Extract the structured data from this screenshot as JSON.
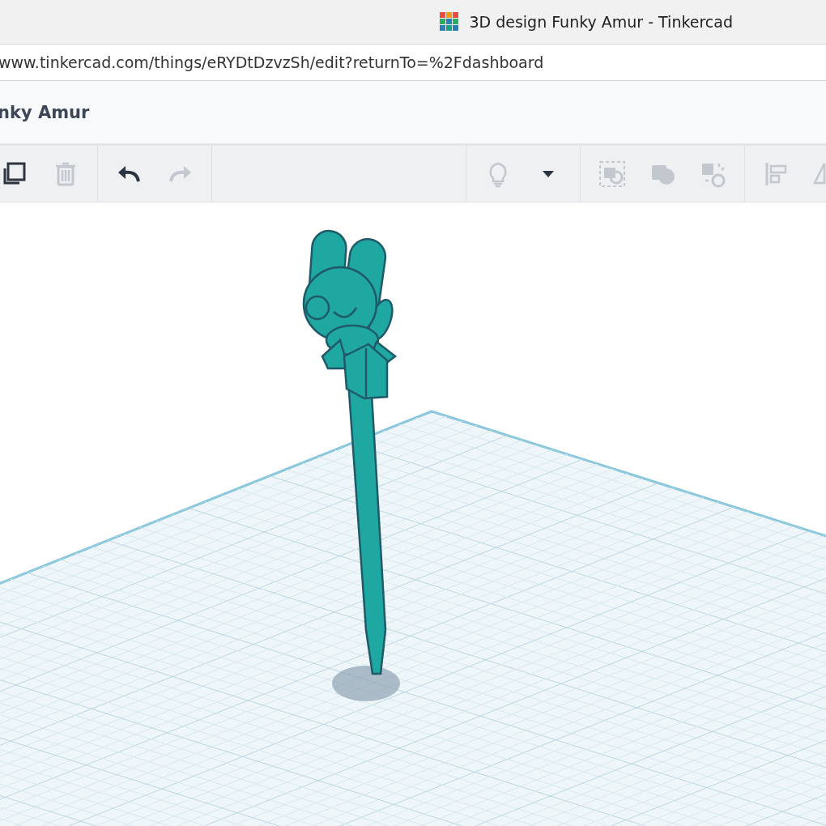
{
  "window": {
    "title": "3D design Funky Amur - Tinkercad"
  },
  "address_bar": {
    "url": "www.tinkercad.com/things/eRYDtDzvzSh/edit?returnTo=%2Fdashboard"
  },
  "header": {
    "title": "nky Amur"
  },
  "toolbar": {
    "left_groups": [
      [
        {
          "kind": "duplicate",
          "disabled": false
        },
        {
          "kind": "delete",
          "disabled": true
        }
      ],
      [
        {
          "kind": "undo",
          "disabled": false
        },
        {
          "kind": "redo",
          "disabled": true
        }
      ]
    ],
    "right_groups": [
      [
        {
          "kind": "light",
          "disabled": true
        },
        {
          "kind": "dropdown",
          "disabled": false
        }
      ],
      [
        {
          "kind": "group",
          "disabled": true
        },
        {
          "kind": "solid",
          "disabled": true
        },
        {
          "kind": "hole",
          "disabled": true
        }
      ],
      [
        {
          "kind": "align",
          "disabled": true
        },
        {
          "kind": "mirror",
          "disabled": true
        }
      ]
    ]
  }
}
